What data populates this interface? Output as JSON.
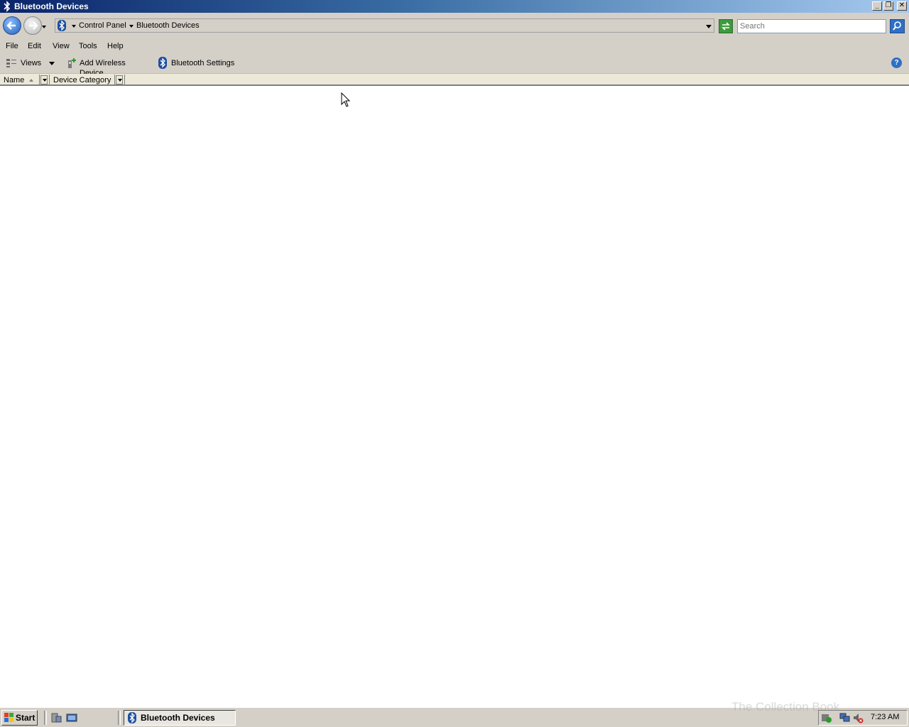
{
  "window": {
    "title": "Bluetooth Devices"
  },
  "address_bar": {
    "breadcrumb": [
      "Control Panel",
      "Bluetooth Devices"
    ],
    "search_placeholder": "Search"
  },
  "menu": {
    "items": [
      "File",
      "Edit",
      "View",
      "Tools",
      "Help"
    ]
  },
  "toolbar": {
    "views_label": "Views",
    "add_wireless_label": "Add Wireless Device",
    "bluetooth_settings_label": "Bluetooth Settings"
  },
  "columns": {
    "name": "Name",
    "device_category": "Device Category"
  },
  "taskbar": {
    "start_label": "Start",
    "task_label": "Bluetooth Devices",
    "clock": "7:23 AM"
  },
  "watermark": "The Collection Book",
  "colors": {
    "title_start": "#0a246a",
    "title_end": "#a6caf0",
    "chrome": "#d4d0c8"
  }
}
